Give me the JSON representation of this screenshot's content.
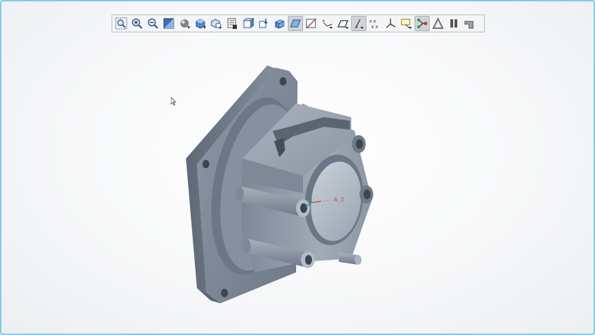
{
  "toolbar": {
    "buttons": [
      {
        "icon": "refit-icon",
        "active": false
      },
      {
        "icon": "zoom-in-icon",
        "active": false
      },
      {
        "icon": "zoom-out-icon",
        "active": false
      },
      {
        "icon": "repaint-icon",
        "active": false
      },
      {
        "icon": "shading-icon",
        "active": false
      },
      {
        "icon": "display-style-icon",
        "active": false
      },
      {
        "icon": "saved-views-icon",
        "active": false
      },
      {
        "icon": "view-manager-icon",
        "active": false
      },
      {
        "icon": "section-icon",
        "active": false
      },
      {
        "icon": "perspective-icon",
        "active": false
      },
      {
        "icon": "orient-icon",
        "active": false
      },
      {
        "icon": "plane-display-icon",
        "active": true
      },
      {
        "icon": "axis-display-icon",
        "active": false
      },
      {
        "icon": "point-display-icon",
        "active": false
      },
      {
        "icon": "csys-display-icon",
        "active": false
      },
      {
        "icon": "annotation-display-icon",
        "active": true
      },
      {
        "icon": "point-tag-icon",
        "active": false
      },
      {
        "icon": "csys-tag-icon",
        "active": false
      },
      {
        "icon": "spin-center-icon",
        "active": false
      },
      {
        "icon": "model-tree-icon",
        "active": true
      },
      {
        "icon": "triangle-icon",
        "active": false
      },
      {
        "icon": "pause-icon",
        "active": false
      },
      {
        "icon": "next-icon",
        "active": false
      }
    ]
  },
  "viewport": {
    "csys_label": "A_3",
    "part_color": "#8a94a2"
  }
}
